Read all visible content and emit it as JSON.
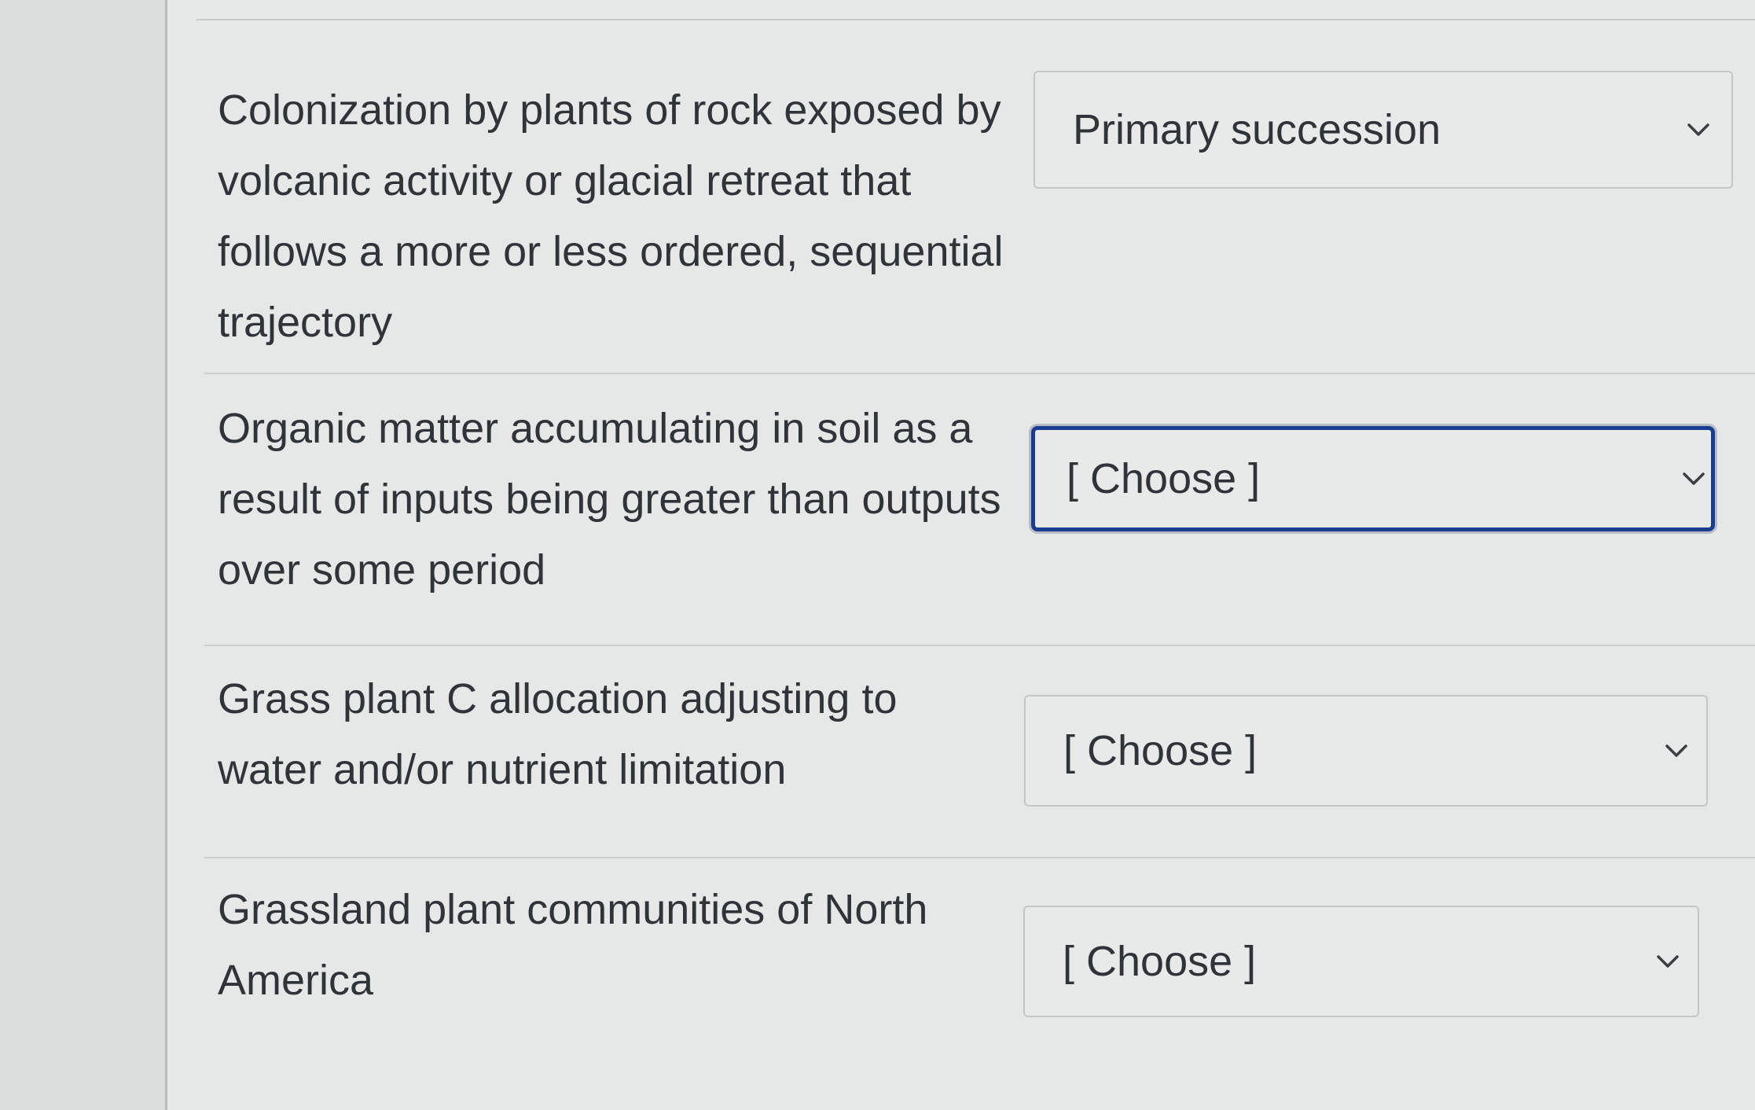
{
  "items": [
    {
      "prompt": "Colonization by plants of rock exposed by volcanic activity or glacial retreat that follows a more or less ordered, sequential trajectory",
      "selected": "Primary succession"
    },
    {
      "prompt": "Organic matter accumulating in soil as a result of inputs being greater than outputs over some period",
      "selected": "[ Choose ]"
    },
    {
      "prompt": "Grass plant C allocation adjusting to water and/or nutrient limitation",
      "selected": "[ Choose ]"
    },
    {
      "prompt": "Grassland plant communities of North America",
      "selected": "[ Choose ]"
    }
  ],
  "icons": {
    "dropdown": "chevron-down-icon"
  },
  "colors": {
    "focus_border": "#1b3d8f",
    "background": "#e6e8e7",
    "text": "#2f3439"
  }
}
